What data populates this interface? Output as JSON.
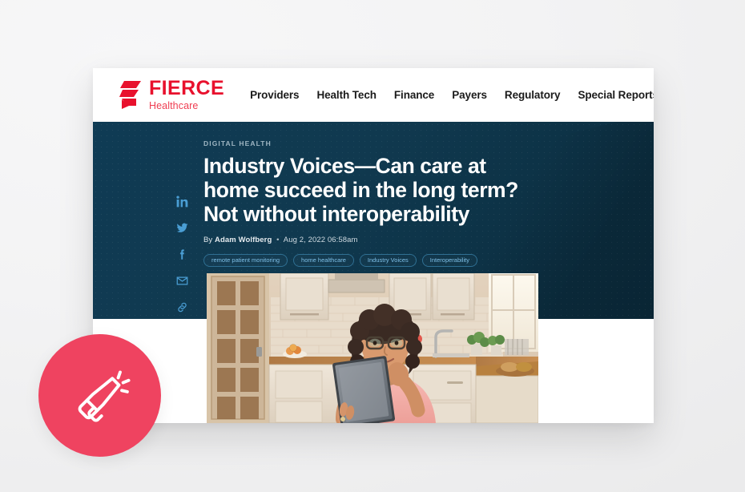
{
  "brand": {
    "name": "FIERCE",
    "sub": "Healthcare",
    "logo_icon": "fierce-flame-logo",
    "primary_color": "#e8112d",
    "secondary_color": "#ef3e52"
  },
  "nav": {
    "items": [
      {
        "label": "Providers"
      },
      {
        "label": "Health Tech"
      },
      {
        "label": "Finance"
      },
      {
        "label": "Payers"
      },
      {
        "label": "Regulatory"
      },
      {
        "label": "Special Reports"
      }
    ]
  },
  "article": {
    "kicker": "DIGITAL HEALTH",
    "headline": "Industry Voices—Can care at home succeed in the long term? Not without interoperability",
    "byline_prefix": "By",
    "author": "Adam Wolfberg",
    "separator": "•",
    "date": "Aug 2, 2022 06:58am",
    "tags": [
      {
        "label": "remote patient monitoring"
      },
      {
        "label": "home healthcare"
      },
      {
        "label": "Industry Voices"
      },
      {
        "label": "Interoperability"
      }
    ],
    "hero_background_color": "#0f3b54",
    "hero_image_alt": "Woman with glasses in a kitchen holding a tablet"
  },
  "share": {
    "items": [
      {
        "icon": "linkedin-icon",
        "label": "Share on LinkedIn"
      },
      {
        "icon": "twitter-icon",
        "label": "Share on Twitter"
      },
      {
        "icon": "facebook-icon",
        "label": "Share on Facebook"
      },
      {
        "icon": "email-icon",
        "label": "Share by email"
      },
      {
        "icon": "link-icon",
        "label": "Copy link"
      }
    ]
  },
  "badge": {
    "icon": "megaphone-icon",
    "color": "#ef4360"
  },
  "page": {
    "background_color": "#f2f2f3",
    "card_background_color": "#ffffff"
  }
}
